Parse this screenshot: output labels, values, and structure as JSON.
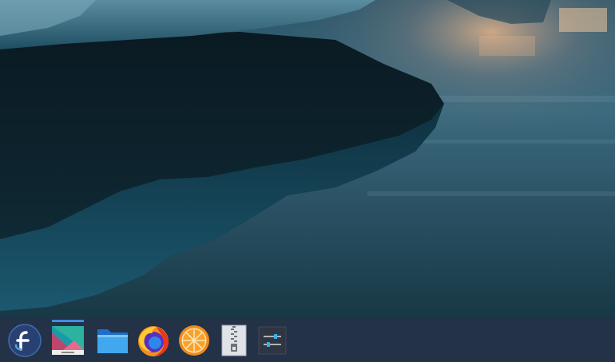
{
  "desktop": {
    "wallpaper": "icy-lake-reflection"
  },
  "taskbar": {
    "background": "#243247",
    "active_indicator_color": "#3d8fe0",
    "items": [
      {
        "id": "app-launcher",
        "icon": "fedora-logo-icon",
        "active": false
      },
      {
        "id": "desktop-pager",
        "icon": "kde-desktop-icon",
        "active": true
      },
      {
        "id": "file-manager",
        "icon": "folder-icon",
        "active": false
      },
      {
        "id": "firefox",
        "icon": "firefox-icon",
        "active": false
      },
      {
        "id": "media-player",
        "icon": "orange-slice-icon",
        "active": false
      },
      {
        "id": "archive-manager",
        "icon": "zip-archive-icon",
        "active": false
      },
      {
        "id": "system-settings",
        "icon": "settings-sliders-icon",
        "active": false
      }
    ]
  }
}
